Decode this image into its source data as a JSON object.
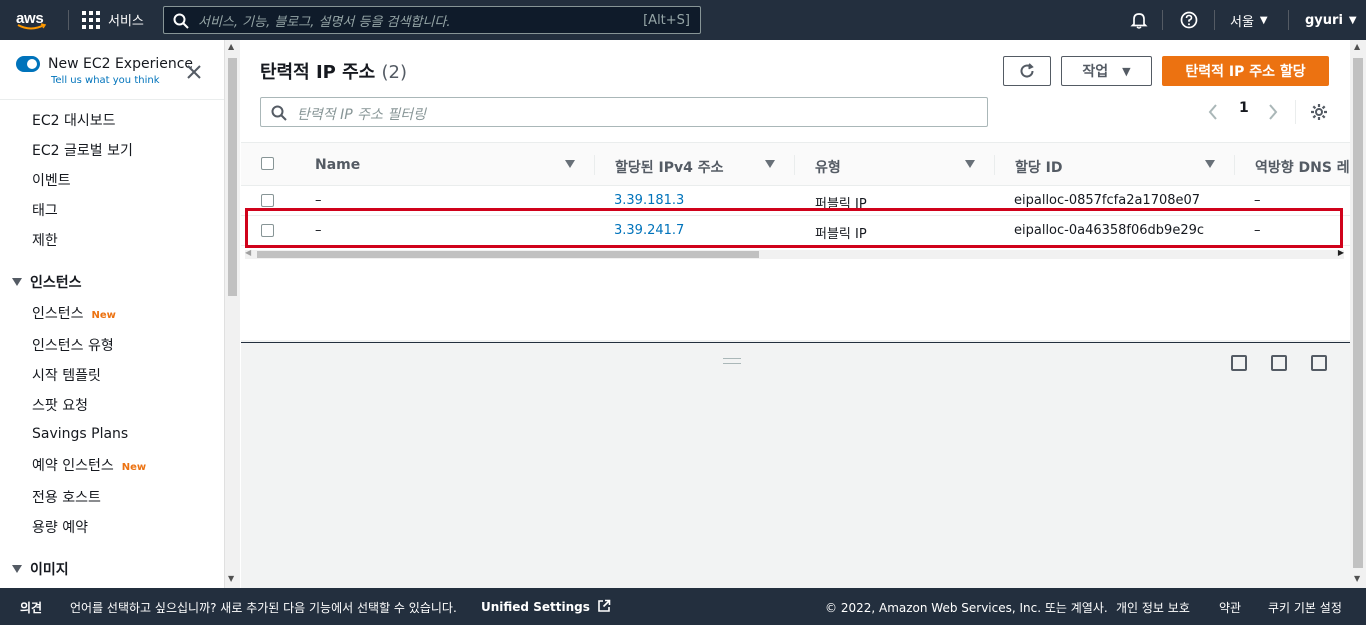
{
  "topnav": {
    "logo_text": "aws",
    "services_label": "서비스",
    "search_placeholder": "서비스, 기능, 블로그, 설명서 등을 검색합니다.",
    "search_shortcut": "[Alt+S]",
    "region_label": "서울",
    "user_label": "gyuri"
  },
  "sidebar": {
    "new_experience_label": "New EC2 Experience",
    "tell_us_label": "Tell us what you think",
    "top_items": [
      {
        "label": "EC2 대시보드"
      },
      {
        "label": "EC2 글로벌 보기"
      },
      {
        "label": "이벤트"
      },
      {
        "label": "태그"
      },
      {
        "label": "제한"
      }
    ],
    "instances_section": "인스턴스",
    "instance_items": [
      {
        "label": "인스턴스",
        "badge": "New"
      },
      {
        "label": "인스턴스 유형",
        "badge": ""
      },
      {
        "label": "시작 템플릿",
        "badge": ""
      },
      {
        "label": "스팟 요청",
        "badge": ""
      },
      {
        "label": "Savings Plans",
        "badge": ""
      },
      {
        "label": "예약 인스턴스",
        "badge": "New"
      },
      {
        "label": "전용 호스트",
        "badge": ""
      },
      {
        "label": "용량 예약",
        "badge": ""
      }
    ],
    "images_section": "이미지"
  },
  "main": {
    "title": "탄력적 IP 주소",
    "count": "(2)",
    "actions_label": "작업",
    "allocate_label": "탄력적 IP 주소 할당",
    "filter_placeholder": "탄력적 IP 주소 필터링",
    "page_number": "1",
    "columns": [
      "Name",
      "할당된 IPv4 주소",
      "유형",
      "할당 ID",
      "역방향 DNS 레"
    ],
    "rows": [
      {
        "name": "–",
        "ip": "3.39.181.3",
        "type": "퍼블릭 IP",
        "alloc": "eipalloc-0857fcfa2a1708e07",
        "rdns": "–"
      },
      {
        "name": "–",
        "ip": "3.39.241.7",
        "type": "퍼블릭 IP",
        "alloc": "eipalloc-0a46358f06db9e29c",
        "rdns": "–"
      }
    ]
  },
  "footer": {
    "feedback": "의견",
    "language_prompt": "언어를 선택하고 싶으십니까? 새로 추가된 다음 기능에서 선택할 수 있습니다.",
    "unified_settings": "Unified Settings",
    "copyright": "© 2022, Amazon Web Services, Inc. 또는 계열사.",
    "privacy": "개인 정보 보호",
    "terms": "약관",
    "cookie": "쿠키 기본 설정"
  },
  "colors": {
    "nav_bg": "#232f3e",
    "accent_orange": "#ec7211",
    "link_blue": "#0073bb",
    "highlight_red": "#d0021b"
  }
}
